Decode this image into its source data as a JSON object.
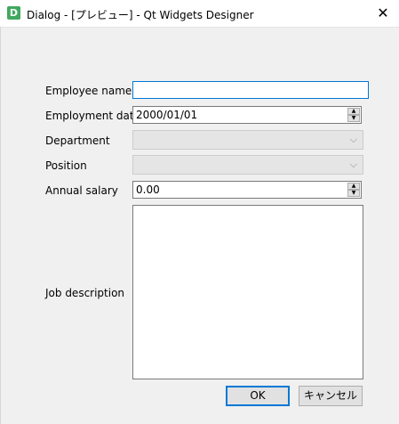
{
  "window": {
    "icon_letter": "D",
    "title": "Dialog - [プレビュー] - Qt Widgets Designer",
    "close_glyph": "✕"
  },
  "form": {
    "employee_name": {
      "label": "Employee name",
      "value": ""
    },
    "employment_date": {
      "label": "Employment date",
      "value": "2000/01/01"
    },
    "department": {
      "label": "Department",
      "value": ""
    },
    "position": {
      "label": "Position",
      "value": ""
    },
    "annual_salary": {
      "label": "Annual salary",
      "value": "0.00"
    },
    "job_description": {
      "label": "Job description",
      "value": ""
    }
  },
  "icons": {
    "spin_up": "▲",
    "spin_down": "▼",
    "chevron": "⌵"
  },
  "buttons": {
    "ok": "OK",
    "cancel": "キャンセル"
  }
}
